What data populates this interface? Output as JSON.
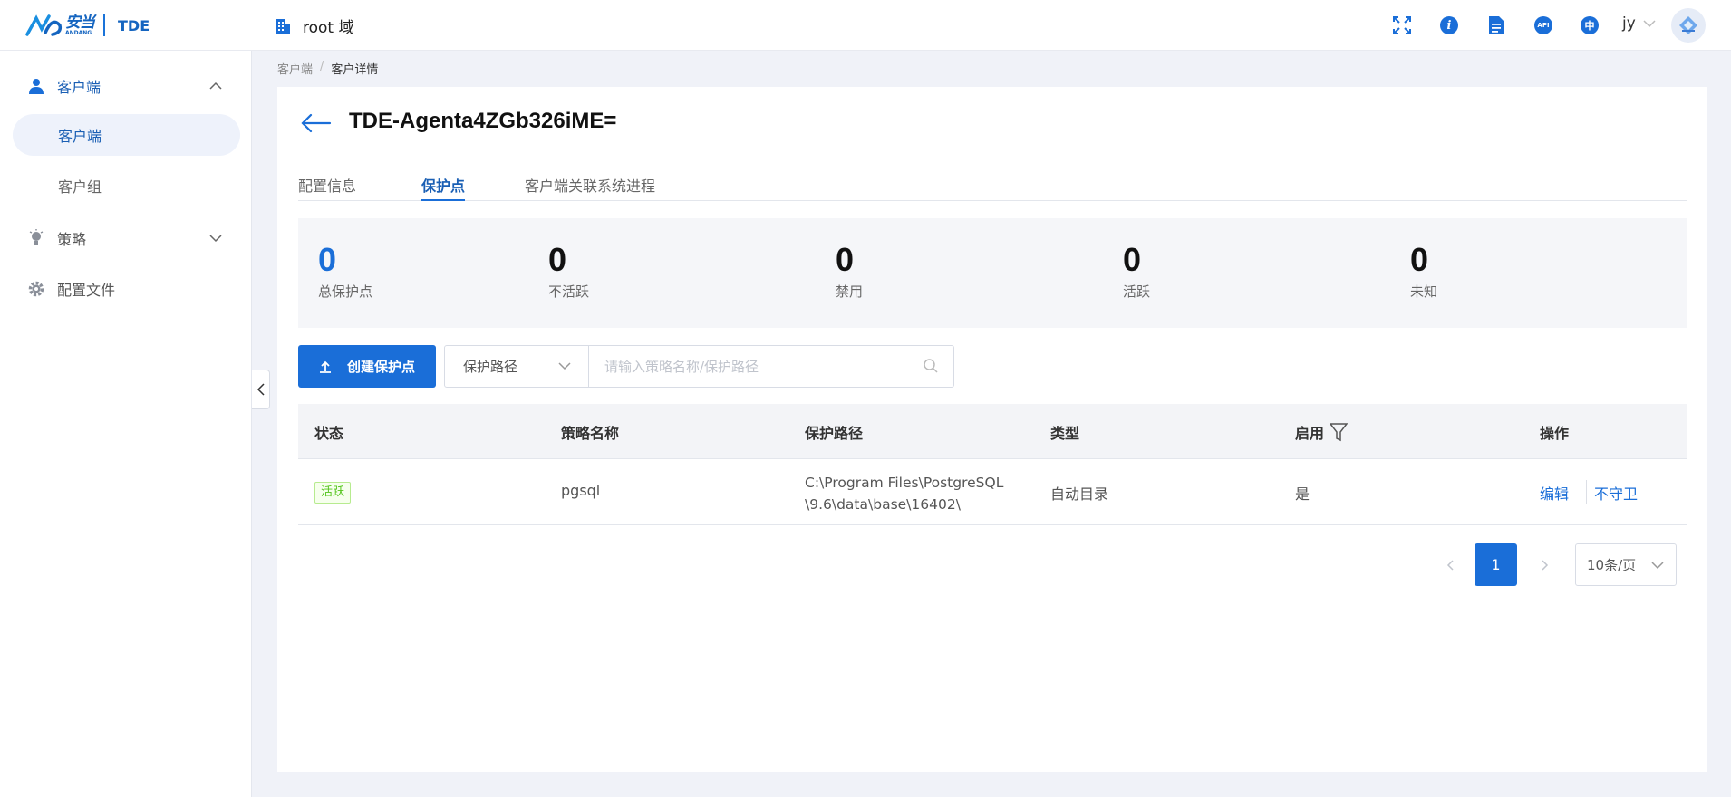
{
  "header": {
    "logo_cn": "安当",
    "logo_en": "ANDANG",
    "product": "TDE",
    "domain": "root 域",
    "icons": [
      "fullscreen-icon",
      "info-icon",
      "document-icon",
      "api-icon",
      "language-icon"
    ],
    "api_label": "API",
    "lang_label": "中",
    "user": "jy"
  },
  "sidebar": {
    "items": [
      {
        "label": "客户端",
        "icon": "user-icon",
        "expanded": true
      },
      {
        "label": "策略",
        "icon": "lightbulb-icon",
        "expanded": false
      },
      {
        "label": "配置文件",
        "icon": "gear-icon"
      }
    ],
    "sub_items": [
      {
        "label": "客户端",
        "active": true
      },
      {
        "label": "客户组",
        "active": false
      }
    ]
  },
  "breadcrumb": {
    "items": [
      "客户端",
      "客户详情"
    ],
    "separator": "/"
  },
  "page": {
    "title": "TDE-Agenta4ZGb326iME="
  },
  "tabs": [
    {
      "label": "配置信息",
      "active": false
    },
    {
      "label": "保护点",
      "active": true
    },
    {
      "label": "客户端关联系统进程",
      "active": false
    }
  ],
  "stats": [
    {
      "value": "0",
      "label": "总保护点"
    },
    {
      "value": "0",
      "label": "不活跃"
    },
    {
      "value": "0",
      "label": "禁用"
    },
    {
      "value": "0",
      "label": "活跃"
    },
    {
      "value": "0",
      "label": "未知"
    }
  ],
  "toolbar": {
    "create_label": "创建保护点",
    "select_value": "保护路径",
    "search_placeholder": "请输入策略名称/保护路径"
  },
  "table": {
    "columns": [
      "状态",
      "策略名称",
      "保护路径",
      "类型",
      "启用",
      "操作"
    ],
    "rows": [
      {
        "status": "活跃",
        "name": "pgsql",
        "path_line1": "C:\\Program Files\\PostgreSQL",
        "path_line2": "\\9.6\\data\\base\\16402\\",
        "type": "自动目录",
        "enabled": "是",
        "action_edit": "编辑",
        "action_unguard": "不守卫"
      }
    ]
  },
  "pagination": {
    "current_page": "1",
    "page_size": "10条/页"
  },
  "colors": {
    "primary": "#1a6ed8",
    "active_badge": "#52c41a",
    "background": "#f0f2f8"
  }
}
